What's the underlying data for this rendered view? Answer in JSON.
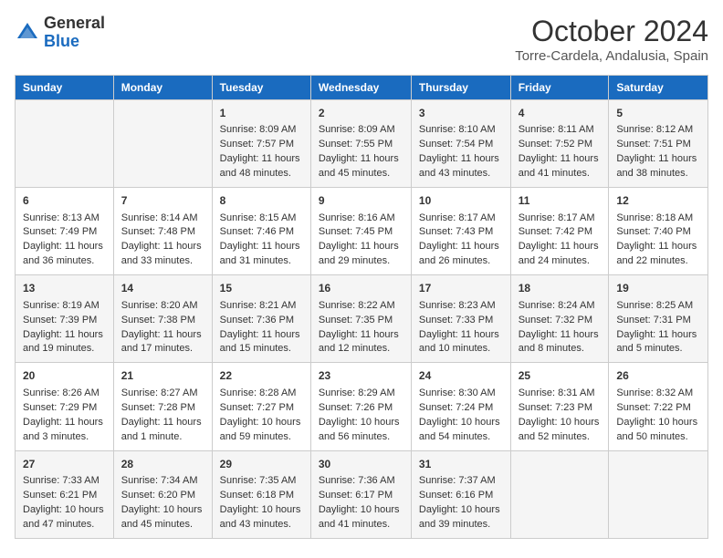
{
  "header": {
    "logo_general": "General",
    "logo_blue": "Blue",
    "month_title": "October 2024",
    "location": "Torre-Cardela, Andalusia, Spain"
  },
  "days_of_week": [
    "Sunday",
    "Monday",
    "Tuesday",
    "Wednesday",
    "Thursday",
    "Friday",
    "Saturday"
  ],
  "weeks": [
    [
      {
        "day": "",
        "sunrise": "",
        "sunset": "",
        "daylight": ""
      },
      {
        "day": "",
        "sunrise": "",
        "sunset": "",
        "daylight": ""
      },
      {
        "day": "1",
        "sunrise": "Sunrise: 8:09 AM",
        "sunset": "Sunset: 7:57 PM",
        "daylight": "Daylight: 11 hours and 48 minutes."
      },
      {
        "day": "2",
        "sunrise": "Sunrise: 8:09 AM",
        "sunset": "Sunset: 7:55 PM",
        "daylight": "Daylight: 11 hours and 45 minutes."
      },
      {
        "day": "3",
        "sunrise": "Sunrise: 8:10 AM",
        "sunset": "Sunset: 7:54 PM",
        "daylight": "Daylight: 11 hours and 43 minutes."
      },
      {
        "day": "4",
        "sunrise": "Sunrise: 8:11 AM",
        "sunset": "Sunset: 7:52 PM",
        "daylight": "Daylight: 11 hours and 41 minutes."
      },
      {
        "day": "5",
        "sunrise": "Sunrise: 8:12 AM",
        "sunset": "Sunset: 7:51 PM",
        "daylight": "Daylight: 11 hours and 38 minutes."
      }
    ],
    [
      {
        "day": "6",
        "sunrise": "Sunrise: 8:13 AM",
        "sunset": "Sunset: 7:49 PM",
        "daylight": "Daylight: 11 hours and 36 minutes."
      },
      {
        "day": "7",
        "sunrise": "Sunrise: 8:14 AM",
        "sunset": "Sunset: 7:48 PM",
        "daylight": "Daylight: 11 hours and 33 minutes."
      },
      {
        "day": "8",
        "sunrise": "Sunrise: 8:15 AM",
        "sunset": "Sunset: 7:46 PM",
        "daylight": "Daylight: 11 hours and 31 minutes."
      },
      {
        "day": "9",
        "sunrise": "Sunrise: 8:16 AM",
        "sunset": "Sunset: 7:45 PM",
        "daylight": "Daylight: 11 hours and 29 minutes."
      },
      {
        "day": "10",
        "sunrise": "Sunrise: 8:17 AM",
        "sunset": "Sunset: 7:43 PM",
        "daylight": "Daylight: 11 hours and 26 minutes."
      },
      {
        "day": "11",
        "sunrise": "Sunrise: 8:17 AM",
        "sunset": "Sunset: 7:42 PM",
        "daylight": "Daylight: 11 hours and 24 minutes."
      },
      {
        "day": "12",
        "sunrise": "Sunrise: 8:18 AM",
        "sunset": "Sunset: 7:40 PM",
        "daylight": "Daylight: 11 hours and 22 minutes."
      }
    ],
    [
      {
        "day": "13",
        "sunrise": "Sunrise: 8:19 AM",
        "sunset": "Sunset: 7:39 PM",
        "daylight": "Daylight: 11 hours and 19 minutes."
      },
      {
        "day": "14",
        "sunrise": "Sunrise: 8:20 AM",
        "sunset": "Sunset: 7:38 PM",
        "daylight": "Daylight: 11 hours and 17 minutes."
      },
      {
        "day": "15",
        "sunrise": "Sunrise: 8:21 AM",
        "sunset": "Sunset: 7:36 PM",
        "daylight": "Daylight: 11 hours and 15 minutes."
      },
      {
        "day": "16",
        "sunrise": "Sunrise: 8:22 AM",
        "sunset": "Sunset: 7:35 PM",
        "daylight": "Daylight: 11 hours and 12 minutes."
      },
      {
        "day": "17",
        "sunrise": "Sunrise: 8:23 AM",
        "sunset": "Sunset: 7:33 PM",
        "daylight": "Daylight: 11 hours and 10 minutes."
      },
      {
        "day": "18",
        "sunrise": "Sunrise: 8:24 AM",
        "sunset": "Sunset: 7:32 PM",
        "daylight": "Daylight: 11 hours and 8 minutes."
      },
      {
        "day": "19",
        "sunrise": "Sunrise: 8:25 AM",
        "sunset": "Sunset: 7:31 PM",
        "daylight": "Daylight: 11 hours and 5 minutes."
      }
    ],
    [
      {
        "day": "20",
        "sunrise": "Sunrise: 8:26 AM",
        "sunset": "Sunset: 7:29 PM",
        "daylight": "Daylight: 11 hours and 3 minutes."
      },
      {
        "day": "21",
        "sunrise": "Sunrise: 8:27 AM",
        "sunset": "Sunset: 7:28 PM",
        "daylight": "Daylight: 11 hours and 1 minute."
      },
      {
        "day": "22",
        "sunrise": "Sunrise: 8:28 AM",
        "sunset": "Sunset: 7:27 PM",
        "daylight": "Daylight: 10 hours and 59 minutes."
      },
      {
        "day": "23",
        "sunrise": "Sunrise: 8:29 AM",
        "sunset": "Sunset: 7:26 PM",
        "daylight": "Daylight: 10 hours and 56 minutes."
      },
      {
        "day": "24",
        "sunrise": "Sunrise: 8:30 AM",
        "sunset": "Sunset: 7:24 PM",
        "daylight": "Daylight: 10 hours and 54 minutes."
      },
      {
        "day": "25",
        "sunrise": "Sunrise: 8:31 AM",
        "sunset": "Sunset: 7:23 PM",
        "daylight": "Daylight: 10 hours and 52 minutes."
      },
      {
        "day": "26",
        "sunrise": "Sunrise: 8:32 AM",
        "sunset": "Sunset: 7:22 PM",
        "daylight": "Daylight: 10 hours and 50 minutes."
      }
    ],
    [
      {
        "day": "27",
        "sunrise": "Sunrise: 7:33 AM",
        "sunset": "Sunset: 6:21 PM",
        "daylight": "Daylight: 10 hours and 47 minutes."
      },
      {
        "day": "28",
        "sunrise": "Sunrise: 7:34 AM",
        "sunset": "Sunset: 6:20 PM",
        "daylight": "Daylight: 10 hours and 45 minutes."
      },
      {
        "day": "29",
        "sunrise": "Sunrise: 7:35 AM",
        "sunset": "Sunset: 6:18 PM",
        "daylight": "Daylight: 10 hours and 43 minutes."
      },
      {
        "day": "30",
        "sunrise": "Sunrise: 7:36 AM",
        "sunset": "Sunset: 6:17 PM",
        "daylight": "Daylight: 10 hours and 41 minutes."
      },
      {
        "day": "31",
        "sunrise": "Sunrise: 7:37 AM",
        "sunset": "Sunset: 6:16 PM",
        "daylight": "Daylight: 10 hours and 39 minutes."
      },
      {
        "day": "",
        "sunrise": "",
        "sunset": "",
        "daylight": ""
      },
      {
        "day": "",
        "sunrise": "",
        "sunset": "",
        "daylight": ""
      }
    ]
  ]
}
